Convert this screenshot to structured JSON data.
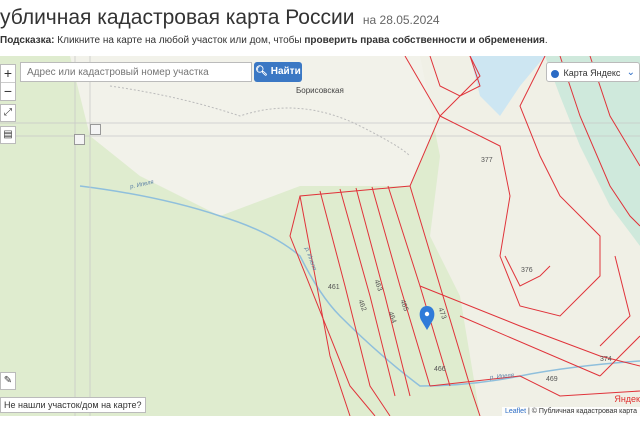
{
  "header": {
    "title": "убличная кадастровая карта России",
    "date": "на 28.05.2024"
  },
  "hint": {
    "label": "Подсказка:",
    "text_before": "Кликните на карте на любой участок или дом, чтобы",
    "bold": "проверить права собственности и обременения",
    "text_after": "."
  },
  "search": {
    "placeholder": "Адрес или кадастровый номер участка",
    "button_label": "Найти"
  },
  "controls": {
    "zoom_in": "+",
    "zoom_out": "−"
  },
  "layer_select": {
    "selected": "Карта Яндекс"
  },
  "not_found_label": "Не нашли участок/дом на карте?",
  "attribution": {
    "leaflet": "Leaflet",
    "separator": " | © Публичная кадастровая карта"
  },
  "yandex_label": "Яндек",
  "map": {
    "place_name": "Борисовская",
    "river_labels": [
      "р. Ипеля",
      "р. Ипеля",
      "р. Ипеля"
    ],
    "parcel_labels": [
      "377",
      "376",
      "374",
      "461",
      "462",
      "463",
      "464",
      "465",
      "473",
      "466",
      "469"
    ],
    "colors": {
      "parcel_stroke": "#e0333a",
      "forest": "#dfeccf",
      "field": "#f2f2ea",
      "water": "#cde6f2",
      "marker": "#2f7bd9"
    }
  }
}
